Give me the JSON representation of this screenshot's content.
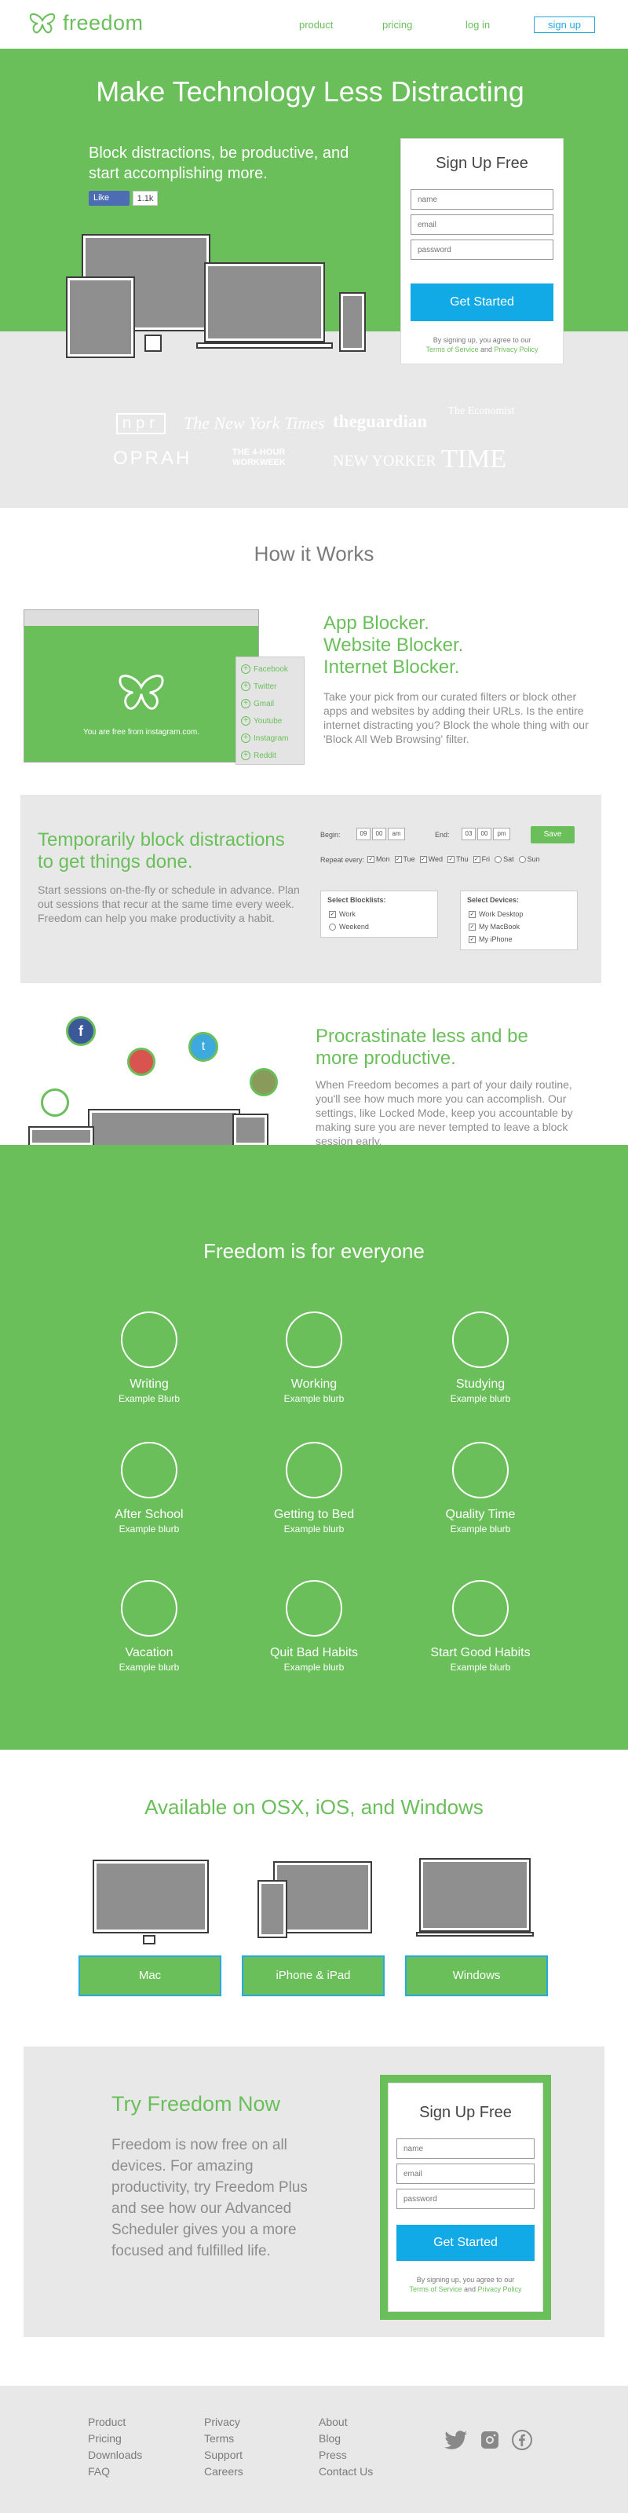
{
  "nav": {
    "brand": "freedom",
    "items": [
      "product",
      "pricing",
      "log in"
    ],
    "signup": "sign up"
  },
  "hero": {
    "title": "Make Technology Less Distracting",
    "subtitle": "Block distractions, be productive, and start accomplishing more.",
    "like_label": "Like",
    "like_count": "1.1k"
  },
  "signup": {
    "title": "Sign Up Free",
    "name_placeholder": "name",
    "email_placeholder": "email",
    "password_placeholder": "password",
    "button": "Get Started",
    "fine_prefix": "By signing up, you agree to our",
    "terms": "Terms of Service",
    "and": "and",
    "privacy": "Privacy Policy"
  },
  "press": [
    "npr",
    "The New York Times",
    "theguardian",
    "The Economist",
    "OPRAH",
    "THE 4-HOUR WORKWEEK",
    "NEW YORKER",
    "TIME"
  ],
  "how": {
    "title": "How it Works",
    "browser_message": "You are free from instagram.com.",
    "blocked_sites": [
      "Facebook",
      "Twitter",
      "Gmail",
      "Youtube",
      "Instagram",
      "Reddit"
    ],
    "feature1_title": [
      "App Blocker.",
      "Website Blocker.",
      "Internet Blocker."
    ],
    "feature1_body": "Take your pick from our curated filters or block other apps and websites by adding their URLs. Is the entire internet distracting you? Block the whole thing with our 'Block All Web Browsing' filter.",
    "feature2_title": "Temporarily block distractions to get things done.",
    "feature2_body": "Start sessions on-the-fly or schedule in advance. Plan out sessions that recur at the same time every week. Freedom can help you make productivity a habit.",
    "feature3_title": "Procrastinate less and be more productive.",
    "feature3_body": "When Freedom becomes a part of your daily routine, you'll see how much more you can accomplish. Our settings, like Locked Mode, keep you accountable by making sure you are never tempted to leave a block session early."
  },
  "scheduler": {
    "begin_label": "Begin:",
    "begin_h": "09",
    "begin_m": "00",
    "begin_ampm": "am",
    "end_label": "End:",
    "end_h": "03",
    "end_m": "00",
    "end_ampm": "pm",
    "save": "Save",
    "repeat_label": "Repeat every:",
    "days": [
      "Mon",
      "Tue",
      "Wed",
      "Thu",
      "Fri",
      "Sat",
      "Sun"
    ],
    "blocklists_title": "Select Blocklists:",
    "blocklists": [
      "Work",
      "Weekend"
    ],
    "devices_title": "Select Devices:",
    "devices": [
      "Work Desktop",
      "My MacBook",
      "My iPhone"
    ]
  },
  "everyone": {
    "title": "Freedom is for everyone",
    "uses": [
      {
        "name": "Writing",
        "blurb": "Example Blurb"
      },
      {
        "name": "Working",
        "blurb": "Example blurb"
      },
      {
        "name": "Studying",
        "blurb": "Example blurb"
      },
      {
        "name": "After School",
        "blurb": "Example blurb"
      },
      {
        "name": "Getting to Bed",
        "blurb": "Example blurb"
      },
      {
        "name": "Quality Time",
        "blurb": "Example blurb"
      },
      {
        "name": "Vacation",
        "blurb": "Example blurb"
      },
      {
        "name": "Quit Bad Habits",
        "blurb": "Example blurb"
      },
      {
        "name": "Start Good Habits",
        "blurb": "Example blurb"
      }
    ]
  },
  "platforms": {
    "title": "Available on OSX, iOS, and Windows",
    "items": [
      "Mac",
      "iPhone & iPad",
      "Windows"
    ]
  },
  "try": {
    "title": "Try Freedom Now",
    "body": "Freedom is now free on all devices. For amazing productivity, try Freedom Plus and see how our Advanced Scheduler gives you a more focused and fulfilled life."
  },
  "footer": {
    "col1": [
      "Product",
      "Pricing",
      "Downloads",
      "FAQ"
    ],
    "col2": [
      "Privacy",
      "Terms",
      "Support",
      "Careers"
    ],
    "col3": [
      "About",
      "Blog",
      "Press",
      "Contact Us"
    ]
  },
  "colors": {
    "brand_green": "#6abf5a",
    "accent_blue": "#11a9e6",
    "light_gray": "#e8e8e8"
  }
}
